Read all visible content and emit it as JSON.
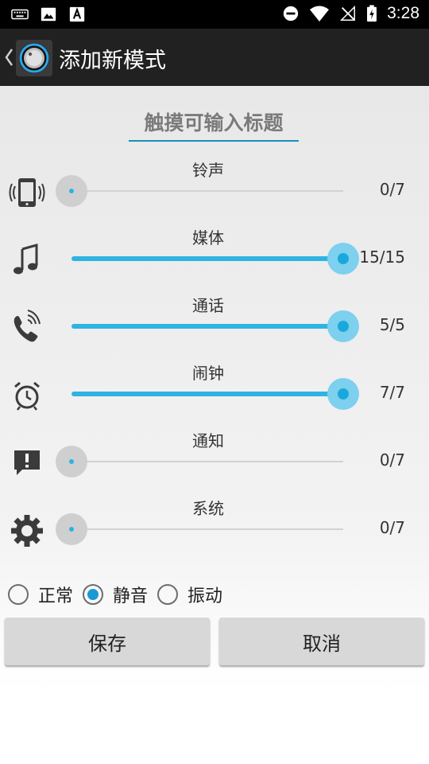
{
  "status_bar": {
    "time": "3:28",
    "left_icons": [
      "keyboard-icon",
      "image-icon",
      "font-a-icon"
    ],
    "right_icons": [
      "do-not-disturb-icon",
      "wifi-icon",
      "no-signal-icon",
      "battery-charging-icon"
    ]
  },
  "header": {
    "title": "添加新模式",
    "back_icon": "back-caret-icon",
    "logo_icon": "volume-knob-icon",
    "bg_color": "#212121"
  },
  "title_field": {
    "placeholder": "触摸可输入标题",
    "value": "",
    "underline_color": "#1a8fb8"
  },
  "volume_rows": [
    {
      "label": "铃声",
      "icon": "ringer-phone-icon",
      "value": 0,
      "max": 7,
      "display": "0/7"
    },
    {
      "label": "媒体",
      "icon": "music-note-icon",
      "value": 15,
      "max": 15,
      "display": "15/15"
    },
    {
      "label": "通话",
      "icon": "call-phone-icon",
      "value": 5,
      "max": 5,
      "display": "5/5"
    },
    {
      "label": "闹钟",
      "icon": "alarm-clock-icon",
      "value": 7,
      "max": 7,
      "display": "7/7"
    },
    {
      "label": "通知",
      "icon": "notification-alert-icon",
      "value": 0,
      "max": 7,
      "display": "0/7"
    },
    {
      "label": "系统",
      "icon": "gear-icon",
      "value": 0,
      "max": 7,
      "display": "0/7"
    }
  ],
  "modes": {
    "options": [
      {
        "label": "正常",
        "checked": false
      },
      {
        "label": "静音",
        "checked": true
      },
      {
        "label": "振动",
        "checked": false
      }
    ]
  },
  "buttons": {
    "save": "保存",
    "cancel": "取消"
  },
  "colors": {
    "accent": "#2eb3e2",
    "thumb_active": "#7dd0ee",
    "thumb_inactive": "#cfcfcf"
  }
}
